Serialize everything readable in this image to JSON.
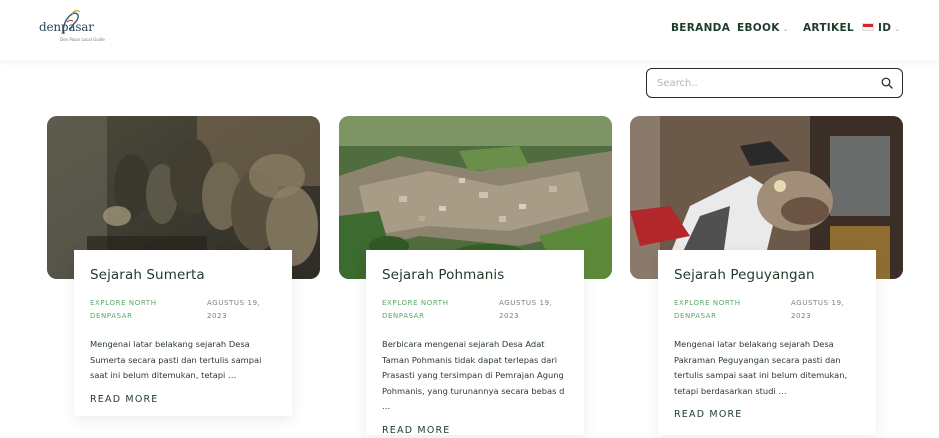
{
  "brand": {
    "name": "denpasar",
    "tagline": "Den Pasar Local Guide"
  },
  "nav": {
    "items": [
      {
        "label": "BERANDA"
      },
      {
        "label": "EBOOK"
      },
      {
        "label": "ARTIKEL"
      },
      {
        "label": "ID"
      }
    ]
  },
  "search": {
    "placeholder": "Search..",
    "value": ""
  },
  "articles": [
    {
      "title": "Sejarah Sumerta",
      "category": "EXPLORE NORTH DENPASAR",
      "date": "AGUSTUS 19, 2023",
      "excerpt": "Mengenai latar belakang sejarah Desa Sumerta secara pasti dan tertulis sampai saat ini belum ditemukan, tetapi …",
      "link": "READ MORE"
    },
    {
      "title": "Sejarah Pohmanis",
      "category": "EXPLORE NORTH DENPASAR",
      "date": "AGUSTUS 19, 2023",
      "excerpt": "Berbicara mengenai sejarah Desa Adat Taman Pohmanis tidak dapat terlepas dari Prasasti yang tersimpan di Pemrajan Agung Pohmanis, yang turunannya secara bebas d …",
      "link": "READ MORE"
    },
    {
      "title": "Sejarah Peguyangan",
      "category": "EXPLORE NORTH DENPASAR",
      "date": "AGUSTUS 19, 2023",
      "excerpt": "Mengenai latar belakang sejarah Desa Pakraman Peguyangan  secara pasti dan tertulis sampai saat ini belum ditemukan, tetapi berdasarkan studi …",
      "link": "READ MORE"
    }
  ],
  "colors": {
    "accent_green": "#5aa865",
    "heading_green": "#1e3b28"
  },
  "icons": {
    "search": "search-icon",
    "chevron": "chevron-down-icon",
    "flag": "indonesia-flag-icon"
  }
}
